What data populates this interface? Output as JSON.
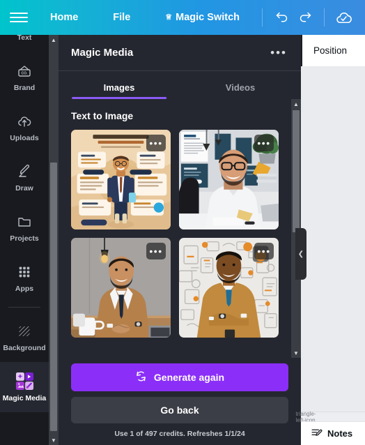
{
  "topbar": {
    "menu_icon": "hamburger-icon",
    "items": [
      {
        "label": "Home",
        "icon": ""
      },
      {
        "label": "File",
        "icon": ""
      },
      {
        "label": "Magic Switch",
        "icon": "crown-icon"
      }
    ],
    "undo_icon": "undo-icon",
    "redo_icon": "redo-icon",
    "save_icon": "cloud-check-icon",
    "accent_start": "#00c4cc",
    "accent_end": "#3b8ce0"
  },
  "sidebar": {
    "items": [
      {
        "label": "Text",
        "icon": "text-icon",
        "active": false
      },
      {
        "label": "Brand",
        "icon": "brand-icon",
        "active": false
      },
      {
        "label": "Uploads",
        "icon": "uploads-icon",
        "active": false
      },
      {
        "label": "Draw",
        "icon": "draw-icon",
        "active": false
      },
      {
        "label": "Projects",
        "icon": "projects-folder-icon",
        "active": false
      },
      {
        "label": "Apps",
        "icon": "apps-grid-icon",
        "active": false
      },
      {
        "label": "Background",
        "icon": "background-icon",
        "active": false
      },
      {
        "label": "Magic Media",
        "icon": "magic-media-icon",
        "active": true
      }
    ]
  },
  "panel": {
    "title": "Magic Media",
    "more_label": "•••",
    "tabs": [
      {
        "label": "Images",
        "active": true
      },
      {
        "label": "Videos",
        "active": false
      }
    ],
    "section_title": "Text to Image",
    "results": [
      {
        "name": "generated-image-1",
        "alt": "Social media infographic illustration with cartoon businessman",
        "overlay": "•••"
      },
      {
        "name": "generated-image-2",
        "alt": "Smiling man in white shirt with glasses at office desk",
        "overlay": "•••"
      },
      {
        "name": "generated-image-3",
        "alt": "Smiling man in tan suit and dark tie at wooden table",
        "overlay": "•••"
      },
      {
        "name": "generated-image-4",
        "alt": "Man in tan suit with blue tie, arms crossed, doodle wall",
        "overlay": "•••"
      }
    ],
    "generate_button": "Generate again",
    "goback_button": "Go back",
    "credits_note": "Use 1 of 497 credits. Refreshes 1/1/24",
    "primary_color": "#8b2ff8",
    "tab_underline_color": "#8b5cf6"
  },
  "right": {
    "toolbar_label": "Position",
    "collapse_icon": "chevron-left-icon",
    "notes_label": "Notes",
    "notes_icon": "notes-pencil-icon",
    "scroll_left_icon": "triangle-left-icon"
  },
  "scrollbars": {
    "up_icon": "▲",
    "down_icon": "▼",
    "left_icon": "◀"
  }
}
